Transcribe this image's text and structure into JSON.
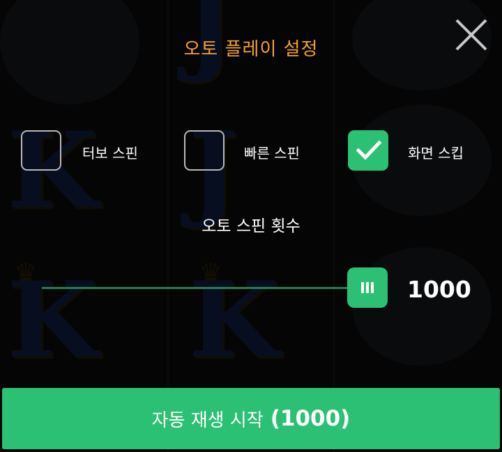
{
  "dialog": {
    "title": "오토 플레이 설정",
    "close_icon": "close-icon"
  },
  "options": [
    {
      "label": "터보 스핀",
      "checked": false
    },
    {
      "label": "빠른 스핀",
      "checked": false
    },
    {
      "label": "화면 스킵",
      "checked": true
    }
  ],
  "spins": {
    "label": "오토 스핀 횟수",
    "value": "1000",
    "slider_fraction": 1.0
  },
  "start": {
    "label": "자동 재생 시작",
    "count": "(1000)"
  },
  "colors": {
    "accent": "#2bc074",
    "title": "#f4a230",
    "track": "#2a7c52"
  }
}
